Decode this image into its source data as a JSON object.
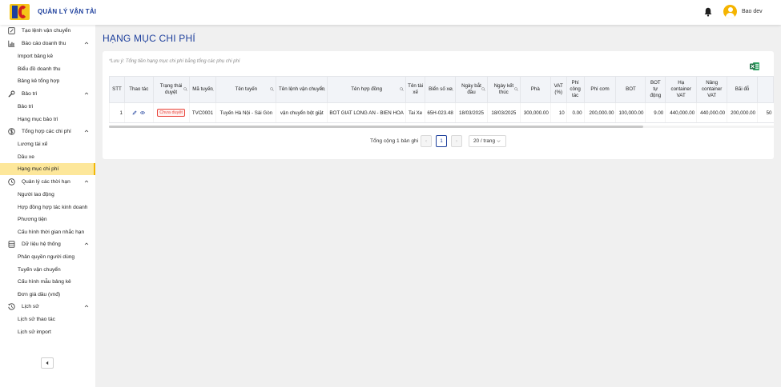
{
  "app": {
    "title": "QUẢN LÝ VẬN TẢI",
    "user": "Bao dev"
  },
  "sidebar": {
    "items": [
      {
        "label": "Tạo lệnh vận chuyển",
        "kind": "top",
        "icon": "edit-square-icon"
      },
      {
        "label": "Báo cáo doanh thu",
        "kind": "top",
        "icon": "bar-chart-icon",
        "expanded": true
      },
      {
        "label": "Import bảng kê",
        "kind": "sub"
      },
      {
        "label": "Biểu đồ doanh thu",
        "kind": "sub"
      },
      {
        "label": "Bảng kê tổng hợp",
        "kind": "sub"
      },
      {
        "label": "Bảo trì",
        "kind": "top",
        "icon": "wrench-icon",
        "expanded": true
      },
      {
        "label": "Bảo trì",
        "kind": "sub"
      },
      {
        "label": "Hạng mục bảo trì",
        "kind": "sub"
      },
      {
        "label": "Tổng hợp các chi phí",
        "kind": "top",
        "icon": "dollar-icon",
        "expanded": true
      },
      {
        "label": "Lương tài xế",
        "kind": "sub"
      },
      {
        "label": "Dầu xe",
        "kind": "sub"
      },
      {
        "label": "Hạng mục chi phí",
        "kind": "sub",
        "active": true
      },
      {
        "label": "Quản lý các thời hạn",
        "kind": "top",
        "icon": "clock-icon",
        "expanded": true
      },
      {
        "label": "Người lao động",
        "kind": "sub"
      },
      {
        "label": "Hợp đồng hợp tác kinh doanh",
        "kind": "sub"
      },
      {
        "label": "Phương tiện",
        "kind": "sub"
      },
      {
        "label": "Cấu hình thời gian nhắc hạn",
        "kind": "sub"
      },
      {
        "label": "Dữ liệu hệ thống",
        "kind": "top",
        "icon": "database-icon",
        "expanded": true
      },
      {
        "label": "Phân quyền người dùng",
        "kind": "sub"
      },
      {
        "label": "Tuyến vận chuyển",
        "kind": "sub"
      },
      {
        "label": "Cấu hình mẫu bảng kê",
        "kind": "sub"
      },
      {
        "label": "Đơn giá dầu (vnđ)",
        "kind": "sub"
      },
      {
        "label": "Lịch sử",
        "kind": "top",
        "icon": "history-icon",
        "expanded": true
      },
      {
        "label": "Lịch sử thao tác",
        "kind": "sub"
      },
      {
        "label": "Lịch sử import",
        "kind": "sub"
      }
    ]
  },
  "page": {
    "title": "HẠNG MỤC CHI PHÍ",
    "note": "*Lưu ý: Tổng tiền hạng mục chi phí bằng tổng các phụ chi phí"
  },
  "table": {
    "columns": [
      {
        "label": "STT",
        "search": false
      },
      {
        "label": "Thao tác",
        "search": false
      },
      {
        "label": "Trạng thái duyệt",
        "search": true
      },
      {
        "label": "Mã tuyến",
        "search": true
      },
      {
        "label": "Tên tuyến",
        "search": true
      },
      {
        "label": "Tên lệnh vận chuyển",
        "search": true
      },
      {
        "label": "Tên hợp đồng",
        "search": true
      },
      {
        "label": "Tên tài xế",
        "search": false
      },
      {
        "label": "Biển số xe",
        "search": true
      },
      {
        "label": "Ngày bắt đầu",
        "search": true
      },
      {
        "label": "Ngày kết thúc",
        "search": true
      },
      {
        "label": "Phà",
        "search": false
      },
      {
        "label": "VAT (%)",
        "search": false
      },
      {
        "label": "Phí công tác",
        "search": false
      },
      {
        "label": "Phí cơm",
        "search": false
      },
      {
        "label": "BOT",
        "search": false
      },
      {
        "label": "BOT tự động",
        "search": false
      },
      {
        "label": "Hạ container VAT",
        "search": false
      },
      {
        "label": "Nâng container VAT",
        "search": false
      },
      {
        "label": "Bãi đỗ",
        "search": false
      },
      {
        "label": "",
        "search": false
      }
    ],
    "rows": [
      {
        "stt": "1",
        "status": "Chưa duyệt",
        "route_code": "TVC0001",
        "route_name": "Tuyến Hà Nội - Sài Gòn",
        "order_name": "vận chuyển bột giặt",
        "contract": "BOT GIAT LONG AN - BIEN HOA",
        "driver": "Tai Xe",
        "plate": "65H-023.48",
        "start": "18/03/2025",
        "end": "18/03/2025",
        "ferry": "300,000.00",
        "vat": "10",
        "work_fee": "0.00",
        "meal_fee": "200,000.00",
        "bot": "100,000.00",
        "bot_auto": "9.00",
        "lower_container": "440,000.00",
        "raise_container": "440,000.00",
        "parking": "200,000.00",
        "extra": "50"
      }
    ]
  },
  "pagination": {
    "total": "Tổng cộng 1 bản ghi",
    "current": "1",
    "prev": "‹",
    "next": "›",
    "page_size": "20 / trang"
  }
}
